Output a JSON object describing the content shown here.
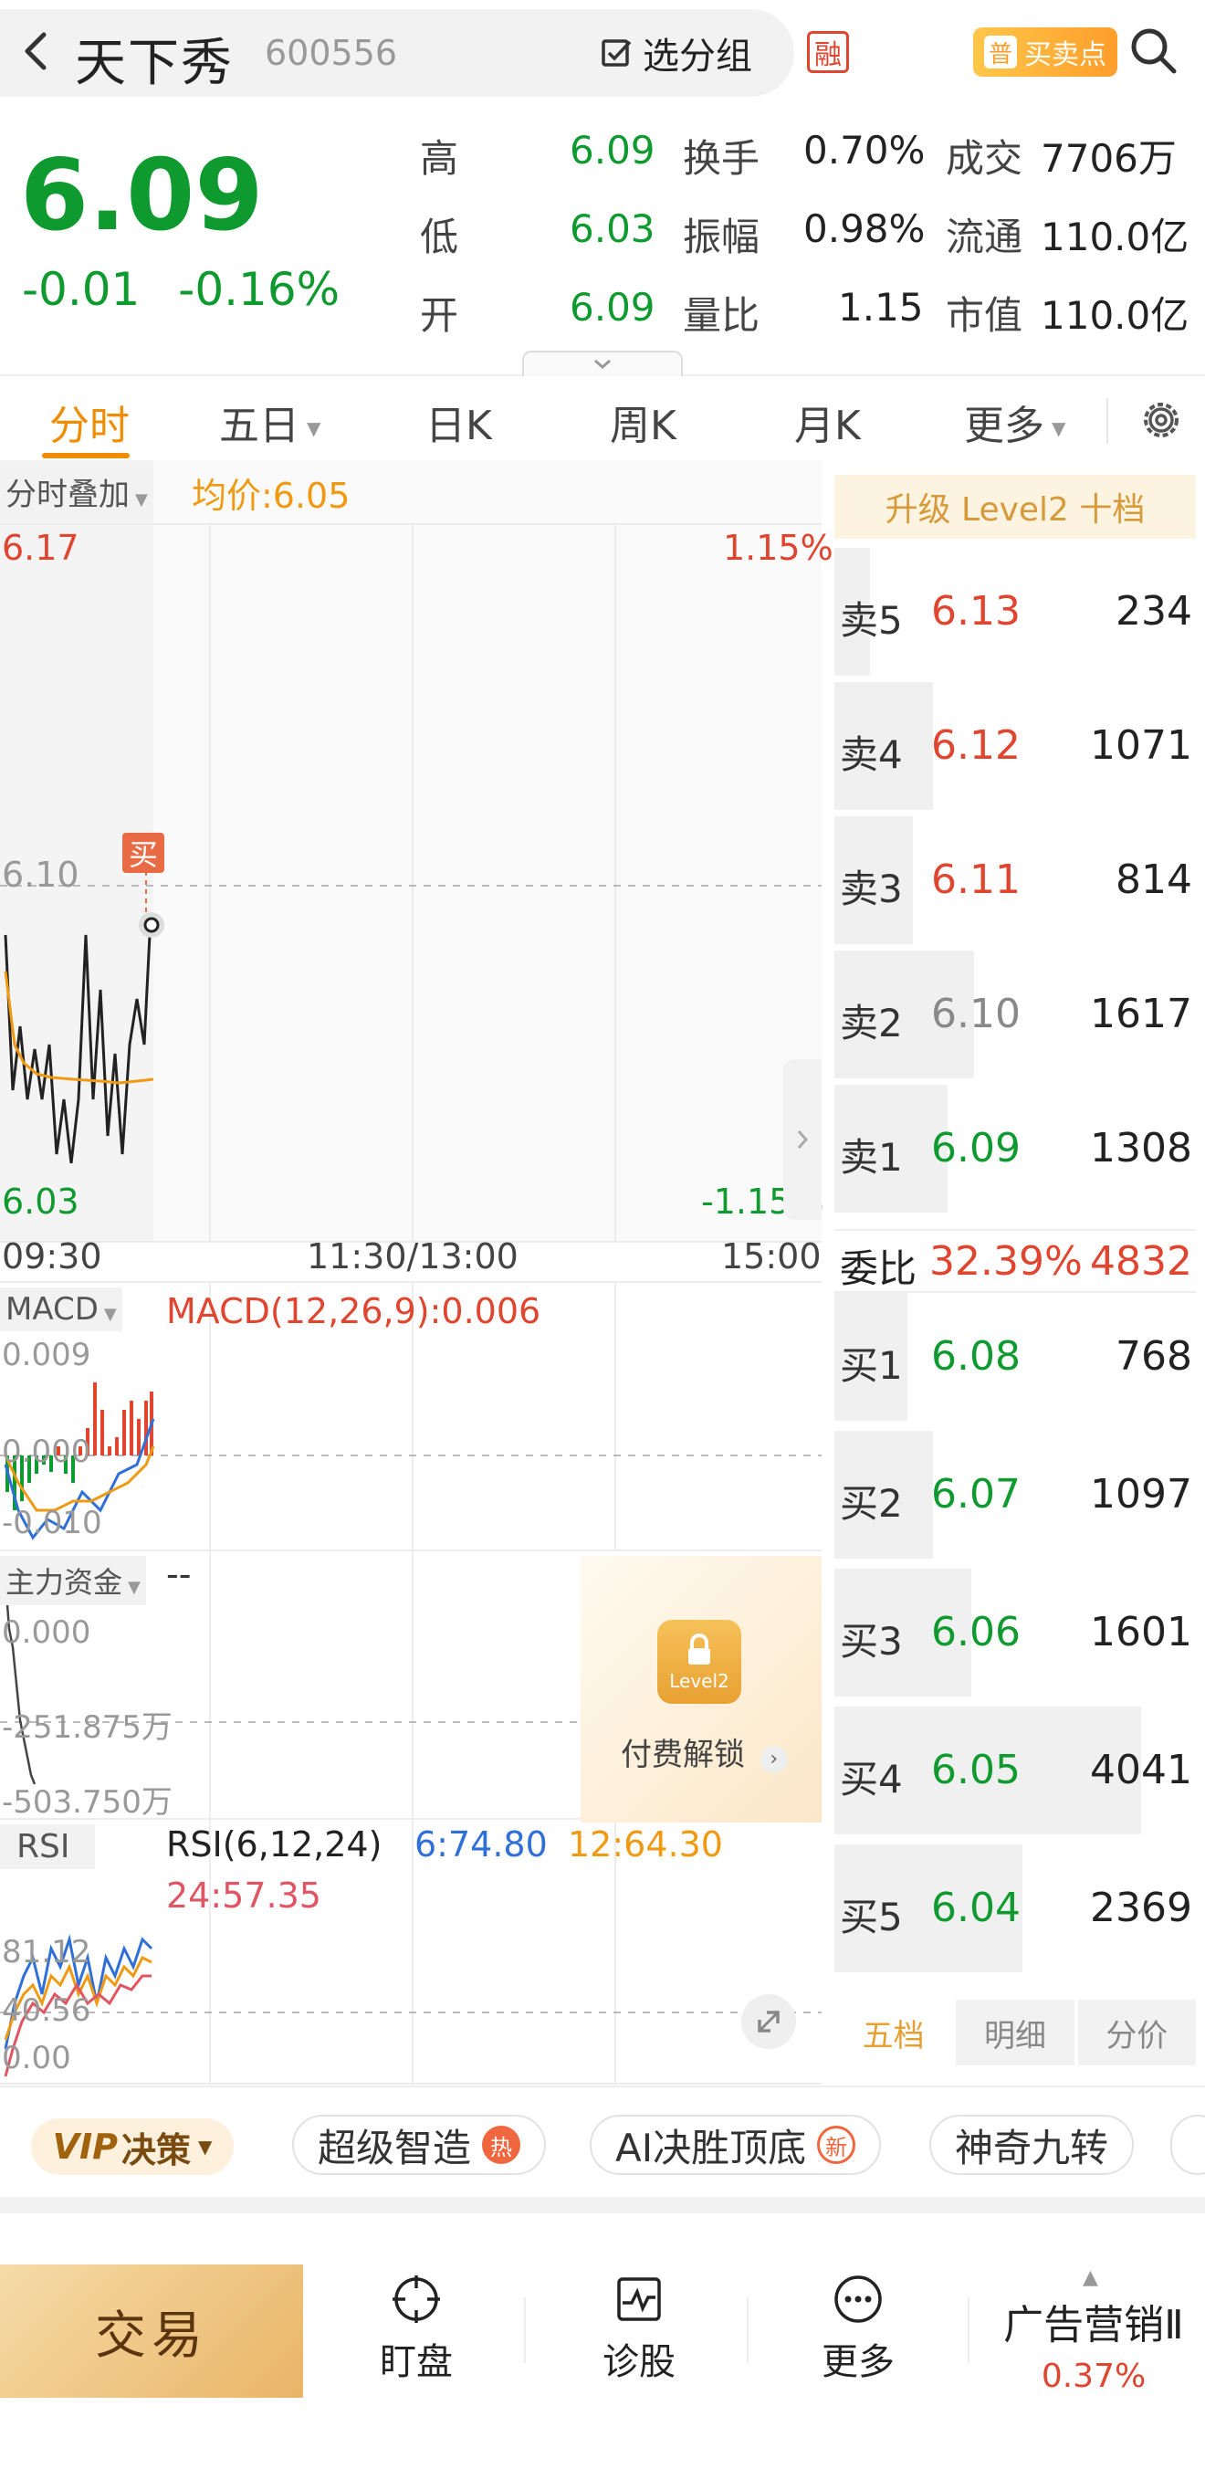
{
  "header": {
    "stock_name": "天下秀",
    "stock_code": "600556",
    "group_label": "选分组",
    "rong_badge": "融",
    "buy_sell_label": "买卖点",
    "buy_sell_icon_text": "普"
  },
  "quote": {
    "price": "6.09",
    "change": "-0.01",
    "change_pct": "-0.16%",
    "stats": [
      {
        "label": "高",
        "value": "6.09"
      },
      {
        "label": "换手",
        "value": "0.70%"
      },
      {
        "label": "成交",
        "value": "7706万"
      },
      {
        "label": "低",
        "value": "6.03"
      },
      {
        "label": "振幅",
        "value": "0.98%"
      },
      {
        "label": "流通",
        "value": "110.0亿"
      },
      {
        "label": "开",
        "value": "6.09"
      },
      {
        "label": "量比",
        "value": "1.15"
      },
      {
        "label": "市值",
        "value": "110.0亿"
      }
    ]
  },
  "tabs": [
    {
      "label": "分时"
    },
    {
      "label": "五日"
    },
    {
      "label": "日K"
    },
    {
      "label": "周K"
    },
    {
      "label": "月K"
    },
    {
      "label": "更多"
    }
  ],
  "intraday": {
    "overlay_label": "分时叠加",
    "avg_label": "均价:6.05",
    "y_high": "6.17",
    "y_mid": "6.10",
    "y_low": "6.03",
    "pct_high": "1.15%",
    "pct_low": "-1.15%",
    "time_start": "09:30",
    "time_mid": "11:30/13:00",
    "time_end": "15:00",
    "buy_marker": "买"
  },
  "macd": {
    "label": "MACD",
    "value_label": "MACD(12,26,9):0.006",
    "y_top": "0.009",
    "y_mid": "0.000",
    "y_bottom": "-0.010"
  },
  "capital": {
    "label": "主力资金",
    "value": "--",
    "y_top": "0.000",
    "y_mid": "-251.875万",
    "y_bottom": "-503.750万",
    "unlock_text": "付费解锁",
    "lock_level": "Level2"
  },
  "rsi": {
    "label": "RSI",
    "params": "RSI(6,12,24)",
    "rsi6": "6:74.80",
    "rsi12": "12:64.30",
    "rsi24": "24:57.35",
    "y_top": "81.12",
    "y_mid": "40.56",
    "y_bottom": "0.00"
  },
  "order_book": {
    "level2_label": "升级 Level2 十档",
    "asks": [
      {
        "label": "卖5",
        "price": "6.13",
        "volume": "234",
        "color": "#e0452f",
        "depth": 0.06
      },
      {
        "label": "卖4",
        "price": "6.12",
        "volume": "1071",
        "color": "#e0452f",
        "depth": 0.28
      },
      {
        "label": "卖3",
        "price": "6.11",
        "volume": "814",
        "color": "#e0452f",
        "depth": 0.21
      },
      {
        "label": "卖2",
        "price": "6.10",
        "volume": "1617",
        "color": "#888888",
        "depth": 0.42
      },
      {
        "label": "卖1",
        "price": "6.09",
        "volume": "1308",
        "color": "#0f9a2f",
        "depth": 0.33
      }
    ],
    "weibi_label": "委比",
    "weibi_pct": "32.39%",
    "weibi_num": "4832",
    "bids": [
      {
        "label": "买1",
        "price": "6.08",
        "volume": "768",
        "color": "#0f9a2f",
        "depth": 0.19
      },
      {
        "label": "买2",
        "price": "6.07",
        "volume": "1097",
        "color": "#0f9a2f",
        "depth": 0.28
      },
      {
        "label": "买3",
        "price": "6.06",
        "volume": "1601",
        "color": "#0f9a2f",
        "depth": 0.41
      },
      {
        "label": "买4",
        "price": "6.05",
        "volume": "4041",
        "color": "#0f9a2f",
        "depth": 1.0
      },
      {
        "label": "买5",
        "price": "6.04",
        "volume": "2369",
        "color": "#0f9a2f",
        "depth": 0.59
      }
    ],
    "tabs": [
      "五档",
      "明细",
      "分价"
    ]
  },
  "features": {
    "vip_label": "决策",
    "vip_prefix": "VIP",
    "chips": [
      {
        "label": "超级智造",
        "tag": "热"
      },
      {
        "label": "AI决胜顶底",
        "tag": "新"
      },
      {
        "label": "神奇九转",
        "tag": ""
      }
    ]
  },
  "bottom": {
    "trade_label": "交易",
    "nav": [
      {
        "label": "盯盘",
        "icon": "target-icon"
      },
      {
        "label": "诊股",
        "icon": "pulse-chart-icon"
      },
      {
        "label": "更多",
        "icon": "more-dots-icon"
      }
    ],
    "ad_title": "广告营销Ⅱ",
    "ad_pct": "0.37%"
  },
  "colors": {
    "up": "#e0452f",
    "down": "#0f9a2f",
    "accent": "#f08c00",
    "avg_line": "#ef9a12"
  }
}
